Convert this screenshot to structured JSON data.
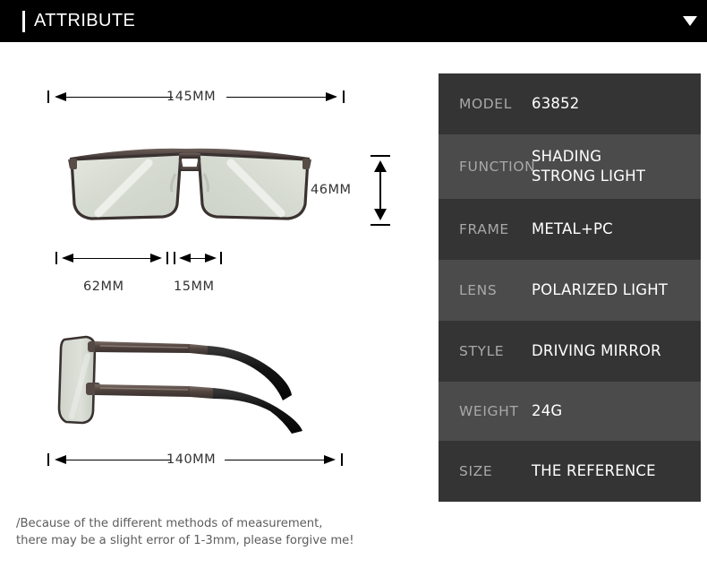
{
  "header": {
    "title": "ATTRIBUTE",
    "chevron_icon": "chevron-down-icon"
  },
  "dimensions": {
    "total_width": "145MM",
    "lens_height": "46MM",
    "lens_width": "62MM",
    "bridge_width": "15MM",
    "temple_length": "140MM"
  },
  "disclaimer": "/Because of the different methods of measurement,\nthere may be a slight error of 1-3mm, please forgive me!",
  "spec_table": {
    "rows": [
      {
        "label": "MODEL",
        "value": "63852"
      },
      {
        "label": "FUNCTION",
        "value": "SHADING\nSTRONG LIGHT"
      },
      {
        "label": "FRAME",
        "value": "METAL+PC"
      },
      {
        "label": "LENS",
        "value": "POLARIZED LIGHT"
      },
      {
        "label": "STYLE",
        "value": "DRIVING MIRROR"
      },
      {
        "label": "WEIGHT",
        "value": "24G"
      },
      {
        "label": "SIZE",
        "value": "THE REFERENCE"
      }
    ]
  },
  "product": {
    "front_view_alt": "sunglasses-front-view",
    "side_view_alt": "sunglasses-side-view",
    "frame_color": "#4a403d",
    "lens_color": "#d9ddd5",
    "temple_tip_color": "#151515"
  },
  "colors": {
    "header_bg": "#000000",
    "row_dark": "#343434",
    "row_light": "#4b4b4b",
    "label_gray": "#a8a8a8",
    "value_white": "#ffffff",
    "page_bg": "#ffffff"
  }
}
